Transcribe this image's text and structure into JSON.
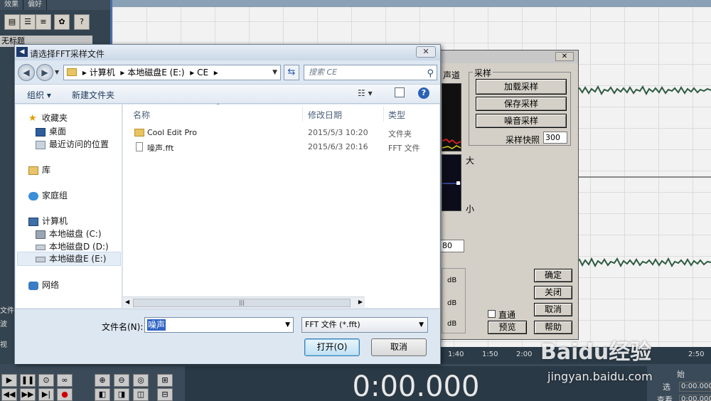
{
  "background_app": {
    "menu_tabs": [
      "效果",
      "偏好"
    ],
    "untitled_label": "无标题",
    "timeline_ticks": [
      "1:40",
      "1:50",
      "2:00",
      "2:50"
    ],
    "time_display": "0:00.000",
    "side_labels": [
      "文件",
      "波",
      "视"
    ],
    "right_labels": [
      "始",
      "选",
      "查看"
    ],
    "right_values": [
      "0:00.000",
      "0:00.000"
    ]
  },
  "noise_dialog": {
    "channel_label": "声道",
    "sample_group_label": "采样",
    "load_button": "加载采样",
    "save_button": "保存采样",
    "noise_button": "噪音采样",
    "snapshot_label": "采样快照",
    "snapshot_value": "300",
    "big_label": "大",
    "small_label": "小",
    "value_field": "80",
    "db_labels": [
      "dB",
      "dB",
      "dB"
    ],
    "direct_label": "直通",
    "ok_button": "确定",
    "close_button": "关闭",
    "cancel_button": "取消",
    "preview_button": "预览",
    "help_button": "帮助"
  },
  "open_dialog": {
    "title": "请选择FFT采样文件",
    "breadcrumb": [
      "计算机",
      "本地磁盘E (E:)",
      "CE"
    ],
    "search_placeholder": "搜索 CE",
    "organize_label": "组织 ▾",
    "new_folder_label": "新建文件夹",
    "nav": {
      "favorites": "收藏夹",
      "desktop": "桌面",
      "recent": "最近访问的位置",
      "libraries": "库",
      "homegroup": "家庭组",
      "computer": "计算机",
      "drive_c": "本地磁盘 (C:)",
      "drive_d": "本地磁盘D (D:)",
      "drive_e": "本地磁盘E (E:)",
      "network": "网络"
    },
    "columns": {
      "name": "名称",
      "date": "修改日期",
      "type": "类型"
    },
    "files": [
      {
        "name": "Cool Edit Pro",
        "date": "2015/5/3 10:20",
        "type": "文件夹"
      },
      {
        "name": "噪声.fft",
        "date": "2015/6/3 20:16",
        "type": "FFT 文件"
      }
    ],
    "filename_label": "文件名(N):",
    "filename_value": "噪声",
    "filetype_value": "FFT 文件 (*.fft)",
    "open_button": "打开(O)",
    "cancel_button": "取消"
  },
  "watermark": {
    "text": "Baidu经验",
    "url": "jingyan.baidu.com"
  }
}
